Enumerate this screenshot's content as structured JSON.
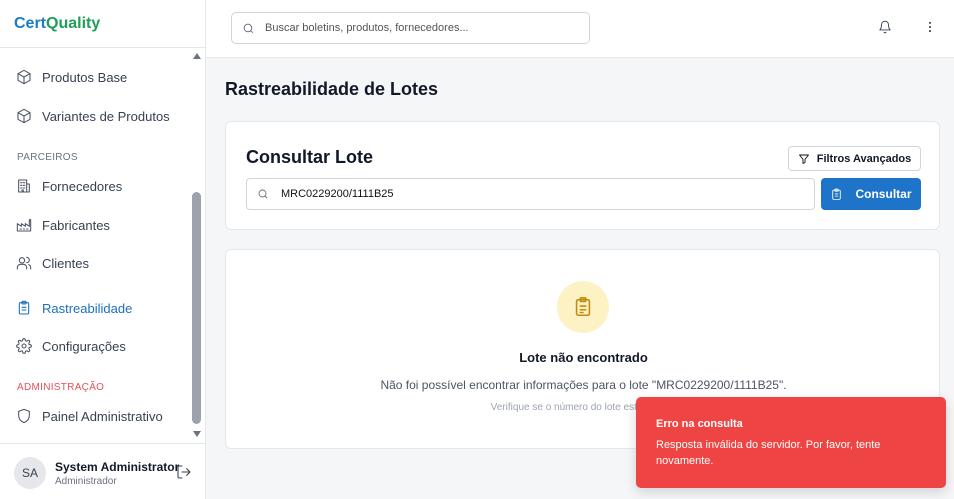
{
  "brand": {
    "part1": "Cert",
    "part2": "Quality"
  },
  "sidebar": {
    "items_top": [
      {
        "label": "Produtos Base",
        "icon": "box-icon"
      },
      {
        "label": "Variantes de Produtos",
        "icon": "box-icon"
      }
    ],
    "section_parceiros": "PARCEIROS",
    "items_parceiros": [
      {
        "label": "Fornecedores",
        "icon": "building-icon"
      },
      {
        "label": "Fabricantes",
        "icon": "factory-icon"
      },
      {
        "label": "Clientes",
        "icon": "users-icon"
      }
    ],
    "item_rastreabilidade": {
      "label": "Rastreabilidade",
      "icon": "clipboard-icon",
      "active": true
    },
    "item_configuracoes": {
      "label": "Configurações",
      "icon": "gear-icon"
    },
    "section_admin": "ADMINISTRAÇÃO",
    "item_painel": {
      "label": "Painel Administrativo",
      "icon": "shield-icon"
    }
  },
  "user": {
    "initials": "SA",
    "name": "System Administrator",
    "role": "Administrador"
  },
  "topbar": {
    "search_placeholder": "Buscar boletins, produtos, fornecedores..."
  },
  "page": {
    "title": "Rastreabilidade de Lotes"
  },
  "consult": {
    "title": "Consultar Lote",
    "filters_label": "Filtros Avançados",
    "lot_value": "MRC0229200/1111B25",
    "submit_label": "Consultar"
  },
  "result": {
    "title": "Lote não encontrado",
    "description": "Não foi possível encontrar informações para o lote \"MRC0229200/1111B25\".",
    "hint": "Verifique se o número do lote está correto"
  },
  "toast": {
    "title": "Erro na consulta",
    "message": "Resposta inválida do servidor. Por favor, tente novamente."
  },
  "colors": {
    "accent": "#1e74c8",
    "brand_green": "#1e9e57",
    "error": "#ef4444",
    "admin_label": "#e0525b"
  }
}
